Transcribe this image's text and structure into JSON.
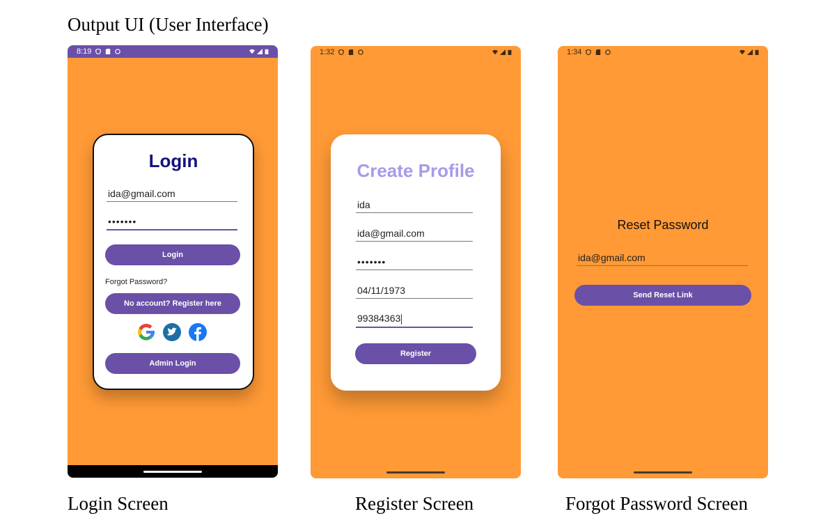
{
  "document": {
    "title": "Output UI (User Interface)"
  },
  "captions": {
    "login": "Login Screen",
    "register": "Register Screen",
    "forgot": "Forgot Password Screen"
  },
  "colors": {
    "background_orange": "#ff9a36",
    "primary_purple": "#6a50a7",
    "login_heading": "#14137a",
    "register_heading": "#a69be8",
    "card": "#ffffff"
  },
  "login_screen": {
    "status_time": "8:19",
    "status_icons": [
      "shield-icon",
      "sd-card-icon",
      "face-icon",
      "wifi-icon",
      "signal-icon",
      "battery-icon"
    ],
    "heading": "Login",
    "email_value": "ida@gmail.com",
    "password_value": "•••••••",
    "login_button": "Login",
    "forgot_password": "Forgot Password?",
    "register_button": "No account? Register here",
    "social_icons": [
      "google-icon",
      "twitter-icon",
      "facebook-icon"
    ],
    "admin_button": "Admin Login"
  },
  "register_screen": {
    "status_time": "1:32",
    "status_icons": [
      "shield-icon",
      "sd-card-icon",
      "face-icon",
      "wifi-icon",
      "signal-icon",
      "battery-icon"
    ],
    "heading": "Create Profile",
    "name_value": "ida",
    "email_value": "ida@gmail.com",
    "password_value": "•••••••",
    "dob_value": "04/11/1973",
    "phone_value": "99384363",
    "register_button": "Register"
  },
  "forgot_screen": {
    "status_time": "1:34",
    "status_icons": [
      "shield-icon",
      "sd-card-icon",
      "face-icon",
      "wifi-icon",
      "signal-icon",
      "battery-icon"
    ],
    "heading": "Reset Password",
    "email_value": "ida@gmail.com",
    "send_button": "Send Reset Link"
  }
}
